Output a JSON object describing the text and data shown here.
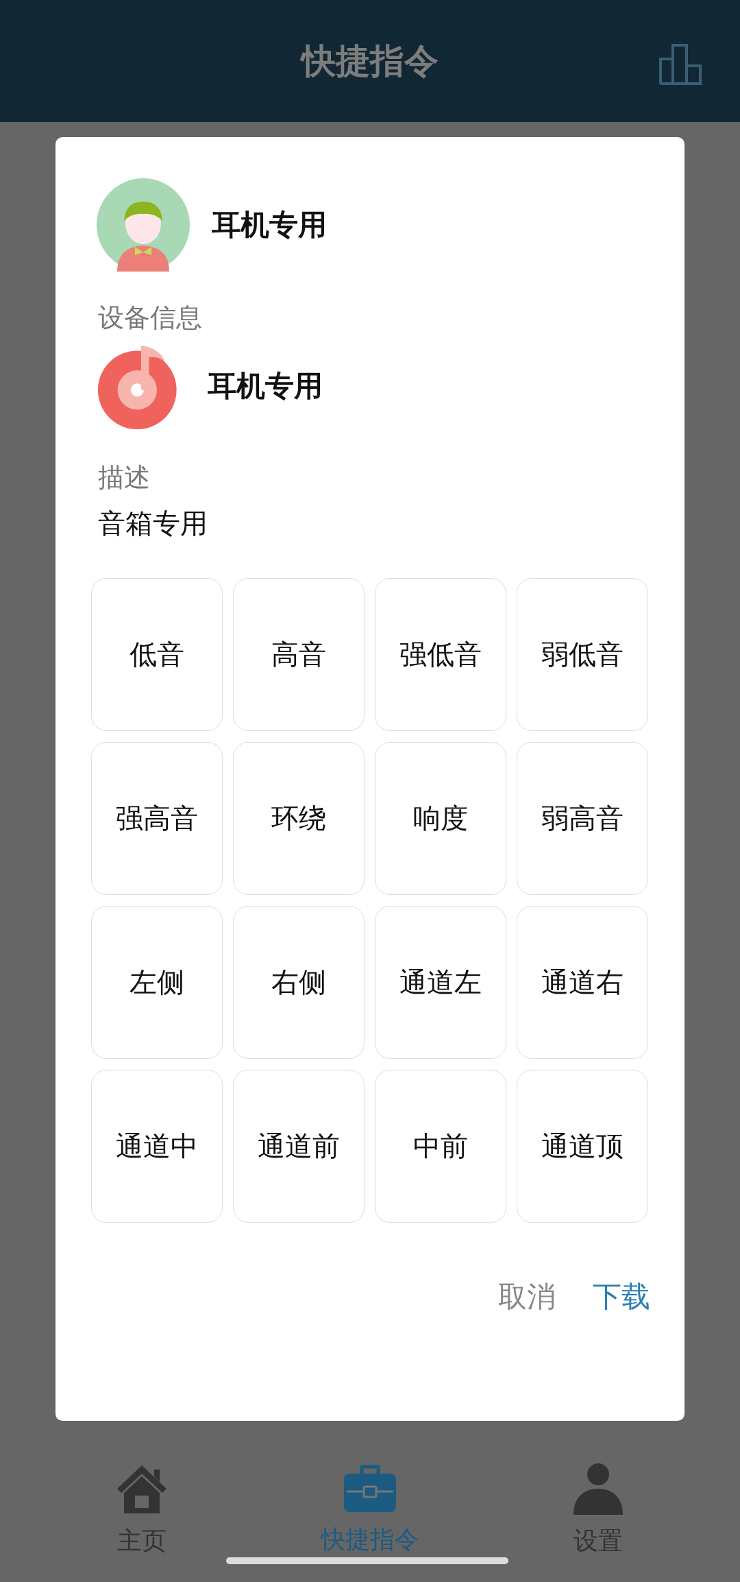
{
  "header": {
    "title": "快捷指令"
  },
  "dialog": {
    "profile_name": "耳机专用",
    "device_section": "设备信息",
    "device_name": "耳机专用",
    "description_label": "描述",
    "description": "音箱专用",
    "commands": [
      "低音",
      "高音",
      "强低音",
      "弱低音",
      "强高音",
      "环绕",
      "响度",
      "弱高音",
      "左侧",
      "右侧",
      "通道左",
      "通道右",
      "通道中",
      "通道前",
      "中前",
      "通道顶"
    ],
    "actions": [
      {
        "label": "取消",
        "kind": "cancel"
      },
      {
        "label": "下载",
        "kind": "confirm"
      }
    ]
  },
  "bottom_nav": [
    {
      "label": "主页",
      "kind": "home",
      "selected": false
    },
    {
      "label": "快捷指令",
      "kind": "tools",
      "selected": true
    },
    {
      "label": "设置",
      "kind": "user",
      "selected": false
    }
  ]
}
